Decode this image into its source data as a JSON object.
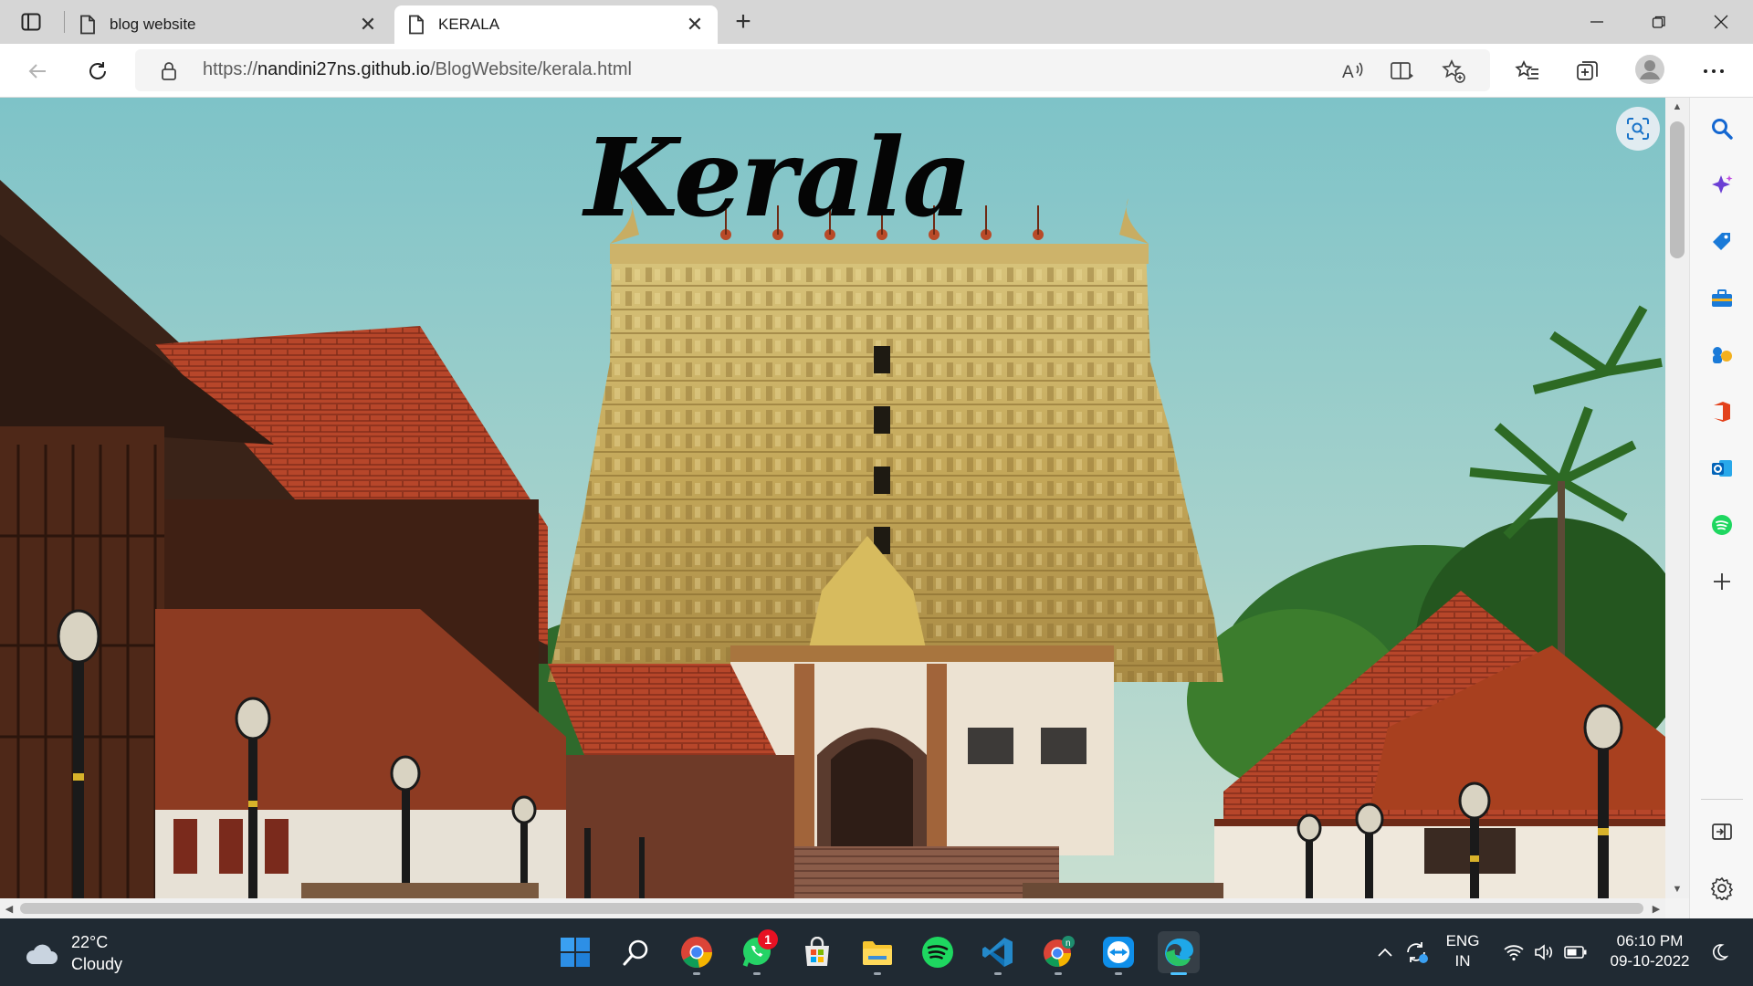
{
  "browser": {
    "tabs": [
      {
        "title": "blog website",
        "active": false
      },
      {
        "title": "KERALA",
        "active": true
      }
    ],
    "address": {
      "scheme": "https://",
      "host": "nandini27ns.github.io",
      "path": "/BlogWebsite/kerala.html"
    }
  },
  "page": {
    "heading": "Kerala",
    "background_description_icon": "temple-photo"
  },
  "sidebar": {
    "items": [
      "search-icon",
      "copilot-icon",
      "shopping-icon",
      "tools-icon",
      "games-icon",
      "office-icon",
      "outlook-icon",
      "spotify-icon",
      "add-icon"
    ],
    "bottom": [
      "split-screen-icon",
      "settings-icon"
    ]
  },
  "taskbar": {
    "weather": {
      "temp": "22°C",
      "condition": "Cloudy"
    },
    "apps": [
      "start",
      "search",
      "chrome",
      "whatsapp",
      "microsoft-store",
      "file-explorer",
      "spotify",
      "vscode",
      "chrome-profile",
      "teamviewer",
      "edge"
    ],
    "whatsapp_badge": "1",
    "language": {
      "line1": "ENG",
      "line2": "IN"
    },
    "clock": {
      "time": "06:10 PM",
      "date": "09-10-2022"
    }
  },
  "colors": {
    "accent": "#0078d4",
    "taskbar": "#202a33",
    "tabstrip": "#d6d6d6"
  }
}
